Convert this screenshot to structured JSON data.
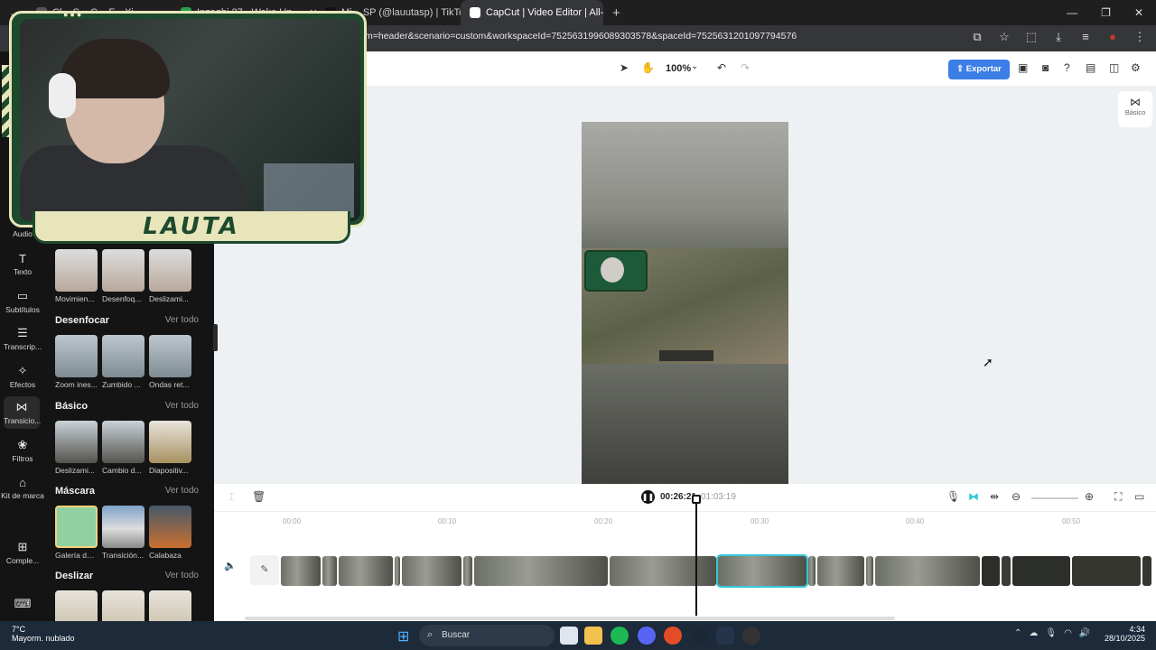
{
  "browser": {
    "tabs": [
      {
        "label": "Cl... S... C... F... Xi...",
        "active": false
      },
      {
        "label": "Inzaghi 27 - Wake Up...",
        "active": false
      },
      {
        "label": "Mi... SP (@lauutasp) | TikTo",
        "active": false
      },
      {
        "label": "CapCut | Video Editor | All-i",
        "active": true
      }
    ],
    "url": "m=header&scenario=custom&workspaceId=7525631996089303578&spaceId=7525631201097794576"
  },
  "rail": [
    {
      "label": "Audio",
      "icon": "audio-icon"
    },
    {
      "label": "Texto",
      "icon": "text-icon"
    },
    {
      "label": "Subtítulos",
      "icon": "subtitles-icon"
    },
    {
      "label": "Transcrip...",
      "icon": "transcript-icon"
    },
    {
      "label": "Efectos",
      "icon": "effects-icon"
    },
    {
      "label": "Transicio...",
      "icon": "transitions-icon"
    },
    {
      "label": "Filtros",
      "icon": "filters-icon"
    },
    {
      "label": "Kit de marca",
      "icon": "brand-kit-icon"
    },
    {
      "label": "Comple...",
      "icon": "plugins-icon"
    }
  ],
  "panel": {
    "see_all": "Ver todo",
    "row0": [
      "Movimien...",
      "Desenfoq...",
      "Deslizami..."
    ],
    "sections": [
      {
        "title": "Desenfocar",
        "items": [
          "Zoom ines...",
          "Zumbido ...",
          "Ondas ret..."
        ]
      },
      {
        "title": "Básico",
        "items": [
          "Deslizami...",
          "Cambio d...",
          "Diapositiv..."
        ]
      },
      {
        "title": "Máscara",
        "items": [
          "Galería de ...",
          "Transición...",
          "Calabaza"
        ]
      },
      {
        "title": "Deslizar",
        "items": [
          "",
          "",
          ""
        ]
      }
    ]
  },
  "toolbar": {
    "zoom": "100%",
    "export": "Exportar",
    "side_basic": "Básico"
  },
  "webcam": {
    "name": "LAUTA"
  },
  "timeline": {
    "current": "00:26:21",
    "total": "01:03:19",
    "ruler": [
      "00:00",
      "00:10",
      "00:20",
      "00:30",
      "00:40",
      "00:50"
    ]
  },
  "taskbar": {
    "temp": "7°C",
    "weather": "Mayorm. nublado",
    "search": "Buscar",
    "time": "4:34",
    "date": "28/10/2025"
  }
}
